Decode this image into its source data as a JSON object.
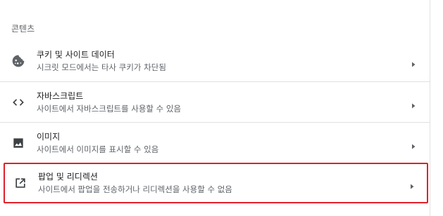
{
  "section": {
    "title": "콘텐츠"
  },
  "items": [
    {
      "icon": "cookie-icon",
      "label": "쿠키 및 사이트 데이터",
      "sublabel": "시크릿 모드에서는 타사 쿠키가 차단됨"
    },
    {
      "icon": "code-icon",
      "label": "자바스크립트",
      "sublabel": "사이트에서 자바스크립트를 사용할 수 있음"
    },
    {
      "icon": "image-icon",
      "label": "이미지",
      "sublabel": "사이트에서 이미지를 표시할 수 있음"
    },
    {
      "icon": "open-in-new-icon",
      "label": "팝업 및 리디렉션",
      "sublabel": "사이트에서 팝업을 전송하거나 리디렉션을 사용할 수 없음"
    }
  ],
  "colors": {
    "highlight_border": "#e0202a",
    "divider": "#e0e0e0",
    "primary_text": "#202124",
    "secondary_text": "#5f6368"
  }
}
